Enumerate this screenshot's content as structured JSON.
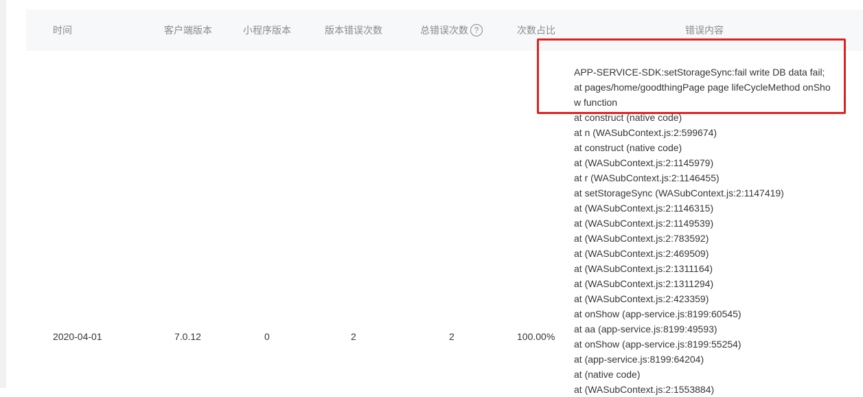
{
  "table": {
    "headers": {
      "time": "时间",
      "client_version": "客户端版本",
      "miniprogram_version": "小程序版本",
      "version_error_count": "版本错误次数",
      "total_error_count": "总错误次数",
      "count_ratio": "次数占比",
      "error_content": "错误内容"
    },
    "help_icon": {
      "icon": "question-circle-icon",
      "glyph": "?"
    },
    "row": {
      "time": "2020-04-01",
      "client_version": "7.0.12",
      "miniprogram_version": "0",
      "version_error_count": "2",
      "total_error_count": "2",
      "count_ratio": "100.00%",
      "error_lines": [
        "APP-SERVICE-SDK:setStorageSync:fail write DB data fail;",
        "at pages/home/goodthingPage page lifeCycleMethod onShow function",
        "at construct (native code)",
        "at n (WASubContext.js:2:599674)",
        "at construct (native code)",
        "at (WASubContext.js:2:1145979)",
        "at r (WASubContext.js:2:1146455)",
        "at setStorageSync (WASubContext.js:2:1147419)",
        "at (WASubContext.js:2:1146315)",
        "at (WASubContext.js:2:1149539)",
        "at (WASubContext.js:2:783592)",
        "at (WASubContext.js:2:469509)",
        "at (WASubContext.js:2:1311164)",
        "at (WASubContext.js:2:1311294)",
        "at (WASubContext.js:2:423359)",
        "at onShow (app-service.js:8199:60545)",
        "at aa (app-service.js:8199:49593)",
        "at onShow (app-service.js:8199:55254)",
        "at (app-service.js:8199:64204)",
        "at (native code)",
        "at (WASubContext.js:2:1553884)"
      ]
    }
  },
  "colors": {
    "header_bg": "#f6f8f9",
    "header_text": "#8a8a8a",
    "body_text": "#353535",
    "highlight_border": "#e02020"
  }
}
